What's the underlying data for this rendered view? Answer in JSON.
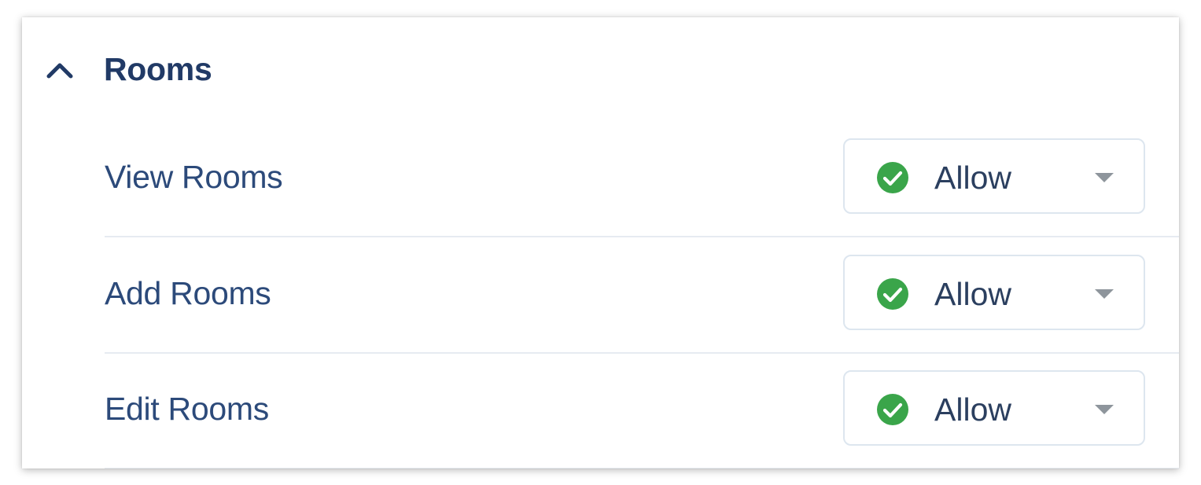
{
  "section": {
    "title": "Rooms",
    "expanded": true,
    "toggle_icon": "chevron-up-icon"
  },
  "colors": {
    "title": "#213a66",
    "label": "#2c4a7a",
    "allow_green": "#3aa54a",
    "border": "#dde6ef",
    "divider": "#e6ebf1",
    "caret": "#8e959c"
  },
  "permissions": [
    {
      "label": "View Rooms",
      "value": "Allow",
      "status_icon": "check-circle-icon",
      "dropdown_icon": "caret-down-icon"
    },
    {
      "label": "Add Rooms",
      "value": "Allow",
      "status_icon": "check-circle-icon",
      "dropdown_icon": "caret-down-icon"
    },
    {
      "label": "Edit Rooms",
      "value": "Allow",
      "status_icon": "check-circle-icon",
      "dropdown_icon": "caret-down-icon"
    }
  ]
}
